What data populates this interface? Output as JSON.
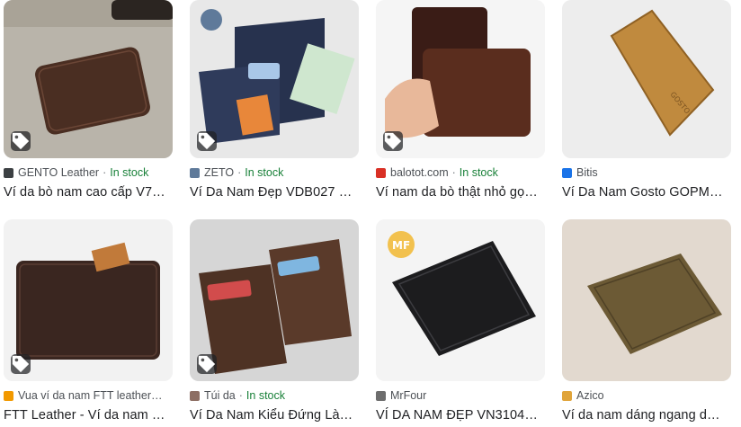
{
  "products": [
    {
      "source": "GENTO Leather",
      "stock": "In stock",
      "title": "Ví da bò nam cao cấp V7…",
      "thumb_bg": "#b9b4aa",
      "wallet_color": "#4a2e22",
      "favicon": "#3c4043"
    },
    {
      "source": "ZETO",
      "stock": "In stock",
      "title": "Ví Da Nam Đẹp VDB027 …",
      "thumb_bg": "#e8e8e8",
      "wallet_color": "#27324e",
      "favicon": "#5f7a9a"
    },
    {
      "source": "balotot.com",
      "stock": "In stock",
      "title": "Ví nam da bò thật nhỏ gọ…",
      "thumb_bg": "#f5f5f5",
      "wallet_color": "#5a2d1e",
      "favicon": "#d93025"
    },
    {
      "source": "Bitis",
      "stock": "",
      "title": "Ví Da Nam Gosto GOPM…",
      "thumb_bg": "#ededed",
      "wallet_color": "#c08a3e",
      "favicon": "#1a73e8"
    },
    {
      "source": "Vua ví da nam FTT leather…",
      "stock": "",
      "title": "FTT Leather - Ví da nam …",
      "thumb_bg": "#f2f2f2",
      "wallet_color": "#3a2620",
      "favicon": "#f29900"
    },
    {
      "source": "Túi da",
      "stock": "In stock",
      "title": "Ví Da Nam Kiểu Đứng Làm …",
      "thumb_bg": "#d6d6d6",
      "wallet_color": "#4e3224",
      "favicon": "#8d6e63"
    },
    {
      "source": "MrFour",
      "stock": "",
      "title": "VÍ DA NAM ĐẸP VN3104…",
      "thumb_bg": "#f4f4f4",
      "wallet_color": "#1c1c1e",
      "favicon": "#6d6d6d"
    },
    {
      "source": "Azico",
      "stock": "",
      "title": "Ví da nam dáng ngang d…",
      "thumb_bg": "#e2d9cf",
      "wallet_color": "#6c5a35",
      "favicon": "#e0a43a"
    }
  ]
}
